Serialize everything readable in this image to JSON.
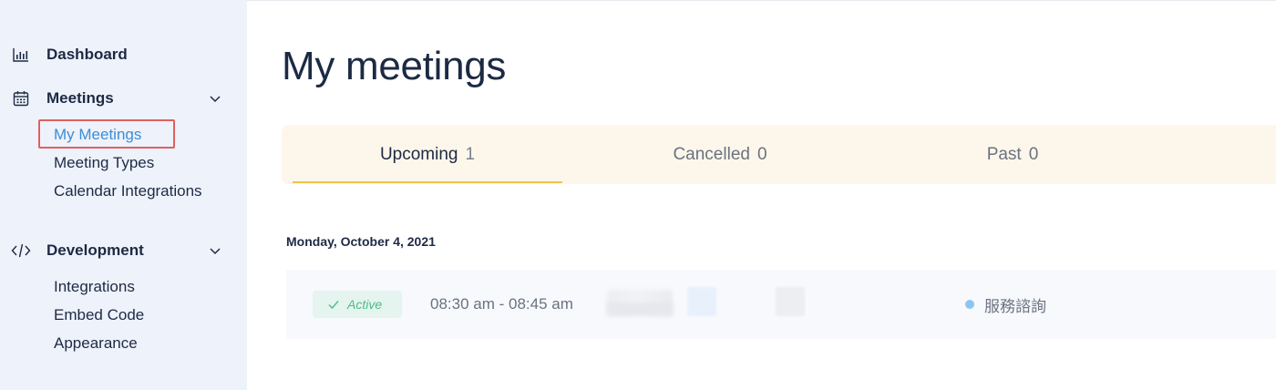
{
  "sidebar": {
    "dashboard": {
      "label": "Dashboard",
      "icon": "bar-chart-icon"
    },
    "meetings": {
      "label": "Meetings",
      "icon": "calendar-icon",
      "items": [
        "My Meetings",
        "Meeting Types",
        "Calendar Integrations"
      ],
      "active_item": "My Meetings"
    },
    "development": {
      "label": "Development",
      "icon": "code-icon",
      "items": [
        "Integrations",
        "Embed Code",
        "Appearance"
      ]
    }
  },
  "main": {
    "title": "My meetings",
    "tabs": [
      {
        "label": "Upcoming",
        "count": "1",
        "selected": true
      },
      {
        "label": "Cancelled",
        "count": "0",
        "selected": false
      },
      {
        "label": "Past",
        "count": "0",
        "selected": false
      }
    ],
    "date_heading": "Monday, October 4, 2021",
    "meeting": {
      "status": "Active",
      "time": "08:30 am - 08:45 am",
      "service": "服務諮詢"
    }
  },
  "colors": {
    "sidebar_bg": "#eef2fb",
    "active_link": "#3b8ed8",
    "highlight_border": "#e06060",
    "tab_bar_bg": "#fcf7ea",
    "tab_underline": "#f2c24b",
    "status_green": "#4cbb8a",
    "service_dot": "#8ec5ee"
  }
}
